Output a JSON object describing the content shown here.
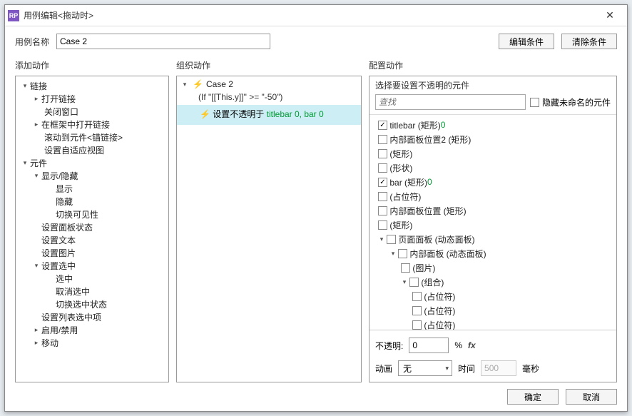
{
  "window": {
    "title": "用例编辑<拖动时>"
  },
  "name_row": {
    "label": "用例名称",
    "value": "Case 2",
    "edit_btn": "编辑条件",
    "clear_btn": "清除条件"
  },
  "sections": {
    "s1": "添加动作",
    "s2": "组织动作",
    "s3": "配置动作"
  },
  "action_tree": {
    "links_header": "链接",
    "links": [
      "打开链接",
      "关闭窗口",
      "在框架中打开链接",
      "滚动到元件<锚链接>",
      "设置自适应视图"
    ],
    "elements_header": "元件",
    "show_hide_header": "显示/隐藏",
    "show_hide": [
      "显示",
      "隐藏",
      "切换可见性"
    ],
    "elements_more": [
      "设置面板状态",
      "设置文本",
      "设置图片"
    ],
    "select_header": "设置选中",
    "select": [
      "选中",
      "取消选中",
      "切换选中状态"
    ],
    "elements_tail": [
      "设置列表选中项",
      "启用/禁用",
      "移动"
    ]
  },
  "org": {
    "case_name": "Case 2",
    "condition": "(If \"[[This.y]]\" >= \"-50\")",
    "action_prefix": "设置不透明于 ",
    "action_targets": "titlebar 0, bar 0"
  },
  "config": {
    "title": "选择要设置不透明的元件",
    "search_placeholder": "查找",
    "hide_unnamed": "隐藏未命名的元件",
    "widgets": [
      {
        "lvl": 0,
        "chk": true,
        "label": "titlebar (矩形) ",
        "suffix": "0"
      },
      {
        "lvl": 0,
        "chk": false,
        "label": "内部面板位置2 (矩形)"
      },
      {
        "lvl": 0,
        "chk": false,
        "label": "(矩形)"
      },
      {
        "lvl": 0,
        "chk": false,
        "label": "(形状)"
      },
      {
        "lvl": 0,
        "chk": true,
        "label": "bar (矩形) ",
        "suffix": "0"
      },
      {
        "lvl": 0,
        "chk": false,
        "label": "(占位符)"
      },
      {
        "lvl": 0,
        "chk": false,
        "label": "内部面板位置 (矩形)"
      },
      {
        "lvl": 0,
        "chk": false,
        "label": "(矩形)"
      },
      {
        "lvl": 0,
        "chk": false,
        "arrow": true,
        "label": "页面面板 (动态面板)"
      },
      {
        "lvl": 1,
        "chk": false,
        "arrow": true,
        "label": "内部面板 (动态面板)"
      },
      {
        "lvl": 2,
        "chk": false,
        "label": "(图片)"
      },
      {
        "lvl": 2,
        "chk": false,
        "arrow": true,
        "label": "(组合)"
      },
      {
        "lvl": 3,
        "chk": false,
        "label": "(占位符)"
      },
      {
        "lvl": 3,
        "chk": false,
        "label": "(占位符)"
      },
      {
        "lvl": 3,
        "chk": false,
        "label": "(占位符)"
      }
    ],
    "opacity_label": "不透明:",
    "opacity_value": "0",
    "opacity_unit": "%",
    "fx": "fx",
    "anim_label": "动画",
    "anim_value": "无",
    "time_label": "时间",
    "time_value": "500",
    "time_unit": "毫秒"
  },
  "footer": {
    "ok": "确定",
    "cancel": "取消"
  }
}
